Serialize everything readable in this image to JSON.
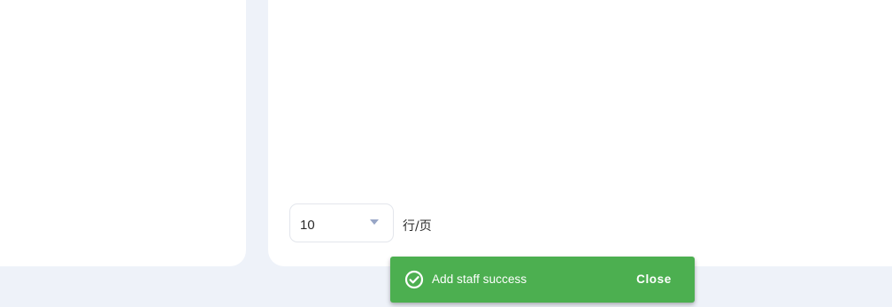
{
  "pagination": {
    "rows_per_page_value": "10",
    "rows_per_page_suffix": "行/页"
  },
  "snackbar": {
    "message": "Add staff success",
    "close_label": "Close",
    "icon": "check-circle-icon",
    "background_color": "#4caf50"
  },
  "colors": {
    "page_background": "#eef2f9",
    "panel_background": "#ffffff",
    "select_caret": "#98a6c6"
  }
}
